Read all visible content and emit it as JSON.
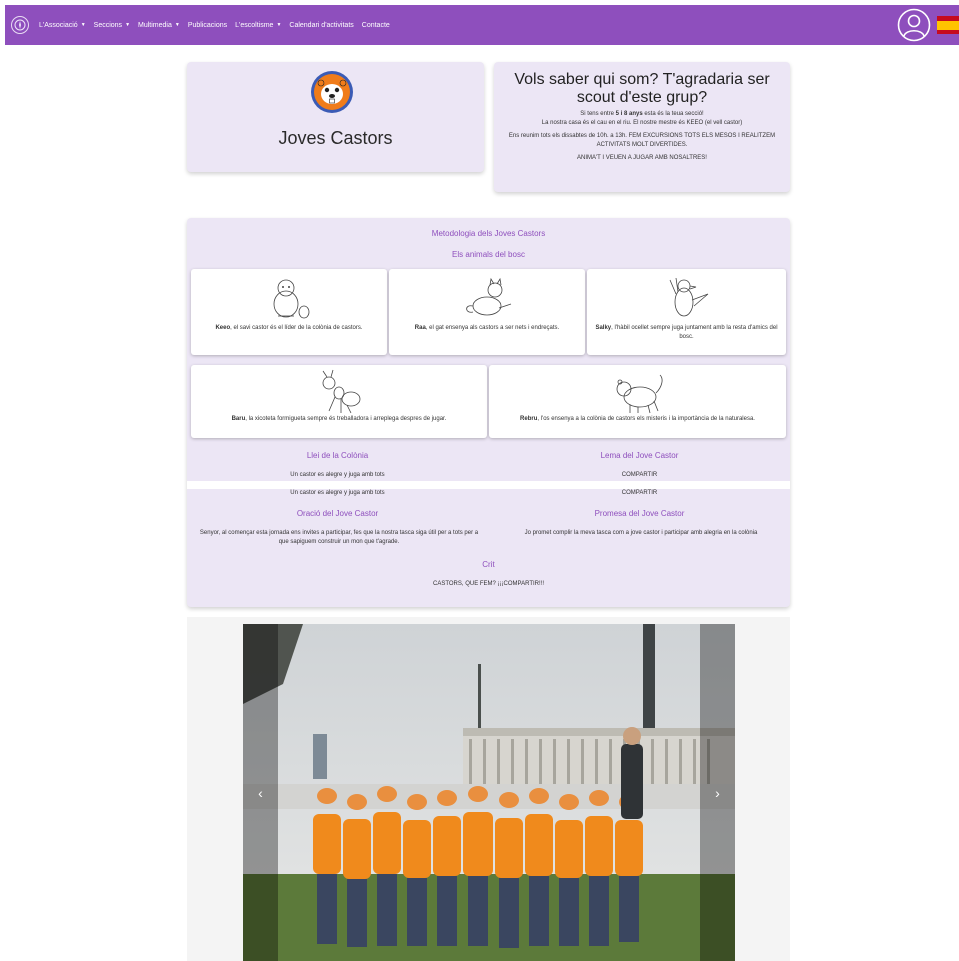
{
  "nav": {
    "items": [
      {
        "label": "L'Associació",
        "dropdown": true
      },
      {
        "label": "Seccions",
        "dropdown": true
      },
      {
        "label": "Multimedia",
        "dropdown": true
      },
      {
        "label": "Publicacions",
        "dropdown": false
      },
      {
        "label": "L'escoltisme",
        "dropdown": true
      },
      {
        "label": "Calendari d'activitats",
        "dropdown": false
      },
      {
        "label": "Contacte",
        "dropdown": false
      }
    ],
    "caret": "▼",
    "color": "#8e4fbd"
  },
  "brand": {
    "title": "Joves Castors",
    "emblem_icon": "beaver-emblem-icon"
  },
  "intro": {
    "title": "Vols saber qui som? T'agradaria ser scout d'este grup?",
    "line1_pre": "Si tens entre ",
    "line1_bold": "5 i 8 anys",
    "line1_post": " esta és la teua secció!",
    "line2": "La nostra casa és el cau en el riu. El nostre mestre és KEEO (el vell castor)",
    "line3": "Ens reunim tots els dissabtes de 10h. a 13h. FEM EXCURSIONS TOTS ELS MESOS I REALITZEM ACTIVITATS MOLT DIVERTIDES.",
    "line4": "ANIMA'T I VEUEN A JUGAR AMB NOSALTRES!"
  },
  "metodologia": {
    "title": "Metodologia dels Joves Castors",
    "subtitle": "Els animals del bosc",
    "animals": [
      {
        "name": "Keeo",
        "text": ", el savi castor és el líder de la colònia de castors."
      },
      {
        "name": "Raa",
        "text": ", el gat ensenya als castors a ser nets i endreçats."
      },
      {
        "name": "Salky",
        "text": ", l'hàbil ocellet sempre juga juntament amb la resta d'amics del bosc."
      },
      {
        "name": "Baru",
        "text": ", la xicoteta formigueta sempre és treballadora i arreplega despres de jugar."
      },
      {
        "name": "Rebru",
        "text": ", l'os ensenya a la colònia de castors els misteris i la importància de la naturalesa."
      }
    ],
    "llei_title": "Llei de la Colònia",
    "llei_text": "Un castor es alegre y juga amb tots",
    "lema_title": "Lema del Jove Castor",
    "lema_text": "COMPARTIR",
    "oracio_title": "Oració del Jove Castor",
    "oracio_text": "Senyor, al començar esta jornada ens invites a participar, fes que la nostra tasca siga útil per a tots per a que sapiguem construir un mon que t'agrade.",
    "promesa_title": "Promesa del Jove Castor",
    "promesa_text": "Jo promet complir la meva tasca com a jove castor i participar amb alegria en la colònia",
    "crit_title": "Crit",
    "crit_text": "CASTORS, QUE FEM? ¡¡¡COMPARTIR!!!"
  },
  "carousel": {
    "prev": "‹",
    "next": "›"
  }
}
